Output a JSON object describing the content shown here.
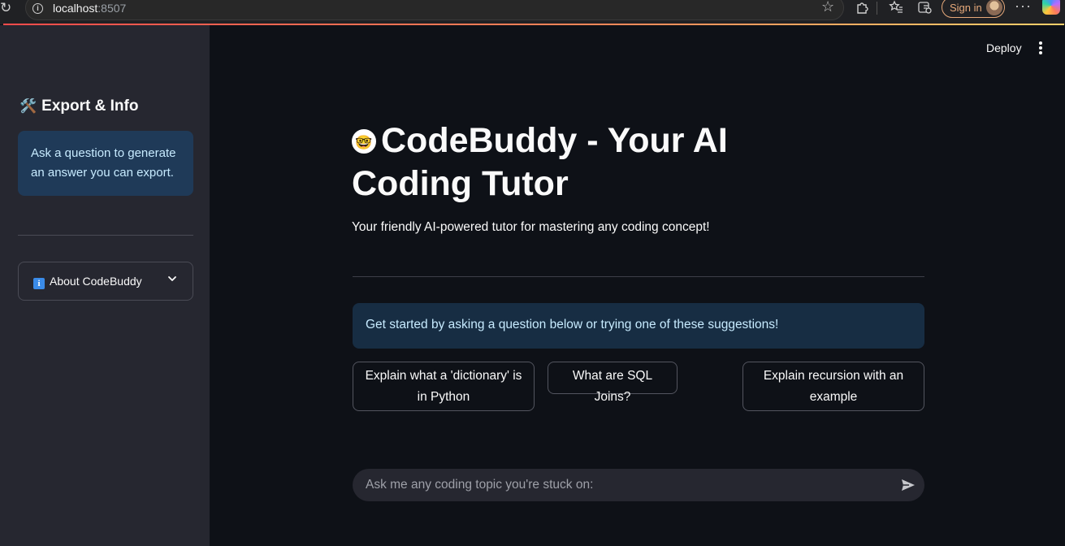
{
  "browser": {
    "url_host": "localhost",
    "url_port": ":8507",
    "sign_in_label": "Sign in"
  },
  "sidebar": {
    "title_icon": "🛠️",
    "title": "Export & Info",
    "info_text": "Ask a question to generate an answer you can export.",
    "expander_icon": "i",
    "expander_label": "About CodeBuddy"
  },
  "header": {
    "deploy_label": "Deploy"
  },
  "main": {
    "title_emoji": "🤓",
    "title": "CodeBuddy - Your AI Coding Tutor",
    "subtitle": "Your friendly AI-powered tutor for mastering any coding concept!",
    "banner": "Get started by asking a question below or trying one of these suggestions!",
    "suggestions": [
      "Explain what a 'dictionary' is in Python",
      "What are SQL Joins?",
      "Explain recursion with an example"
    ],
    "chat_placeholder": "Ask me any coding topic you're stuck on:"
  },
  "colors": {
    "app_bg": "#0e1117",
    "sidebar_bg": "#262730",
    "info_bg": "#1f3a58",
    "info_text": "#c7ebff",
    "accent_loading": "#ff4b4b"
  },
  "icons": [
    "reload-icon",
    "info-icon",
    "star-icon",
    "extensions-icon",
    "favorites-icon",
    "collections-icon",
    "more-icon",
    "copilot-icon",
    "tools-icon",
    "chevron-down-icon",
    "kebab-menu-icon",
    "send-icon"
  ]
}
